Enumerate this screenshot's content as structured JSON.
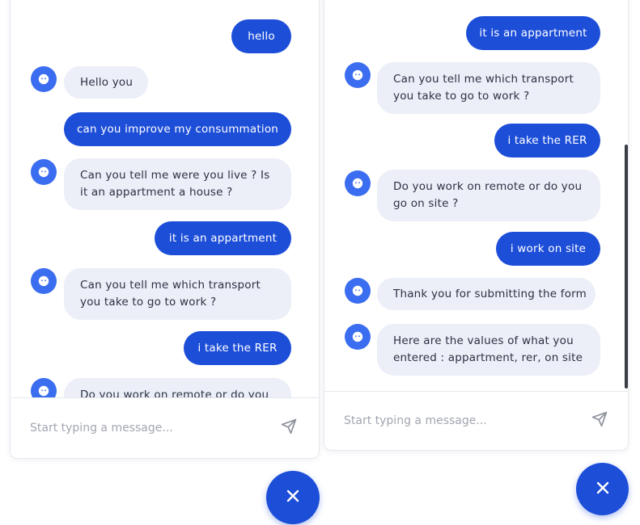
{
  "left_chat": {
    "messages": [
      {
        "role": "user",
        "text": "hello"
      },
      {
        "role": "bot",
        "text": "Hello you"
      },
      {
        "role": "user",
        "text": "can you improve my consummation"
      },
      {
        "role": "bot",
        "text": "Can you tell me were you live ? Is it an appartment a house ?"
      },
      {
        "role": "user",
        "text": "it is an appartment"
      },
      {
        "role": "bot",
        "text": "Can you tell me which transport you take to go to work ?"
      },
      {
        "role": "user",
        "text": "i take the RER"
      },
      {
        "role": "bot",
        "text": "Do you work on remote or do you go on site ?"
      }
    ],
    "input_placeholder": "Start typing a message..."
  },
  "right_chat": {
    "messages": [
      {
        "role": "user",
        "text": "it is an appartment"
      },
      {
        "role": "bot",
        "text": "Can you tell me which transport you take to go to work ?"
      },
      {
        "role": "user",
        "text": "i take the RER"
      },
      {
        "role": "bot",
        "text": "Do you work on remote or do you go on site ?"
      },
      {
        "role": "user",
        "text": "i work on site"
      },
      {
        "role": "bot",
        "text": "Thank you for submitting the form"
      },
      {
        "role": "bot",
        "text": "Here are the values of what you entered : appartment, rer, on site"
      }
    ],
    "input_placeholder": "Start typing a message..."
  },
  "icons": {
    "bot_avatar": "robot-face-icon",
    "send": "paper-plane-icon",
    "close": "close-icon"
  },
  "colors": {
    "accent": "#1d4ed8",
    "avatar": "#3b6df0",
    "bot_bubble": "#eceef8",
    "bot_text": "#2d3142",
    "placeholder": "#a3a6b1"
  }
}
